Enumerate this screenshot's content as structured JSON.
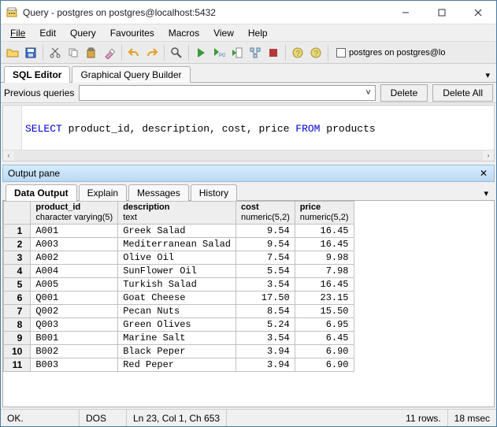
{
  "window": {
    "title": "Query - postgres on postgres@localhost:5432"
  },
  "menu": {
    "file": "File",
    "edit": "Edit",
    "query": "Query",
    "favourites": "Favourites",
    "macros": "Macros",
    "view": "View",
    "help": "Help"
  },
  "toolbar_db": "postgres on postgres@lo",
  "editor_tabs": {
    "sql": "SQL Editor",
    "graphical": "Graphical Query Builder"
  },
  "prev": {
    "label": "Previous queries",
    "delete": "Delete",
    "delete_all": "Delete All"
  },
  "sql": {
    "kw_select": "SELECT",
    "cols": " product_id, description, cost, price ",
    "kw_from": "FROM",
    "table": " products"
  },
  "output": {
    "pane_title": "Output pane",
    "tabs": {
      "data": "Data Output",
      "explain": "Explain",
      "messages": "Messages",
      "history": "History"
    }
  },
  "grid": {
    "columns": [
      {
        "name": "product_id",
        "type": "character varying(5)",
        "align": "left"
      },
      {
        "name": "description",
        "type": "text",
        "align": "left"
      },
      {
        "name": "cost",
        "type": "numeric(5,2)",
        "align": "right"
      },
      {
        "name": "price",
        "type": "numeric(5,2)",
        "align": "right"
      }
    ],
    "rows": [
      [
        "A001",
        "Greek Salad",
        "9.54",
        "16.45"
      ],
      [
        "A003",
        "Mediterranean Salad",
        "9.54",
        "16.45"
      ],
      [
        "A002",
        "Olive Oil",
        "7.54",
        "9.98"
      ],
      [
        "A004",
        "SunFlower Oil",
        "5.54",
        "7.98"
      ],
      [
        "A005",
        "Turkish Salad",
        "3.54",
        "16.45"
      ],
      [
        "Q001",
        "Goat Cheese",
        "17.50",
        "23.15"
      ],
      [
        "Q002",
        "Pecan Nuts",
        "8.54",
        "15.50"
      ],
      [
        "Q003",
        "Green Olives",
        "5.24",
        "6.95"
      ],
      [
        "B001",
        "Marine Salt",
        "3.54",
        "6.45"
      ],
      [
        "B002",
        "Black Peper",
        "3.94",
        "6.90"
      ],
      [
        "B003",
        "Red Peper",
        "3.94",
        "6.90"
      ]
    ]
  },
  "status": {
    "ok": "OK.",
    "enc": "DOS",
    "pos": "Ln 23, Col 1, Ch 653",
    "rows": "11 rows.",
    "time": "18 msec"
  }
}
